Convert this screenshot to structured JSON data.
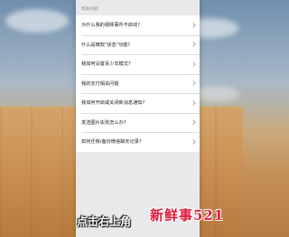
{
  "section_header": "帮助问题",
  "faq_items": [
    {
      "label": "为什么我的视频事件不启动?"
    },
    {
      "label": "什么是微软\"状态\"功能?"
    },
    {
      "label": "我如何设置青少年模式?"
    },
    {
      "label": "我的支付相关问题"
    },
    {
      "label": "我如何开启或关闭新消息通知?"
    },
    {
      "label": "发送图片失败怎么办?"
    },
    {
      "label": "如何迁移/备份微信聊天记录?"
    }
  ],
  "subtitle": "点击右上角",
  "watermark": "新鲜事521"
}
